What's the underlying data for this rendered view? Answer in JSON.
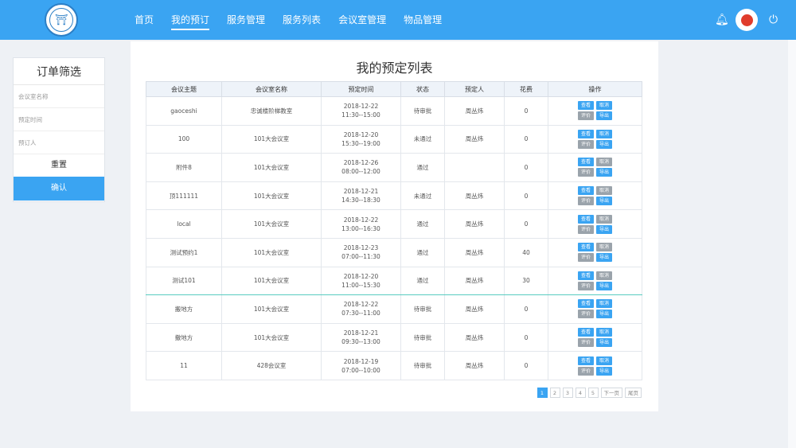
{
  "header": {
    "logo_icon": "university-seal-icon",
    "nav": [
      "首页",
      "我的预订",
      "服务管理",
      "服务列表",
      "会议室管理",
      "物品管理"
    ],
    "active_nav_index": 1
  },
  "sidebar": {
    "title": "订单筛选",
    "fields": [
      {
        "placeholder": "会议室名称"
      },
      {
        "placeholder": "预定时间"
      },
      {
        "placeholder": "预订人"
      }
    ],
    "reset_label": "重置",
    "confirm_label": "确认"
  },
  "main": {
    "title": "我的预定列表",
    "columns": [
      "会议主题",
      "会议室名称",
      "预定时间",
      "状态",
      "预定人",
      "花费",
      "操作"
    ],
    "rows": [
      {
        "topic": "gaoceshi",
        "room": "忠诚楼阶梯教室",
        "date": "2018-12-22",
        "time": "11:30--15:00",
        "status": "待审批",
        "person": "周丛炜",
        "cost": "0",
        "selected": false,
        "ops": [
          [
            "查看",
            "blue"
          ],
          [
            "取消",
            "blue"
          ],
          [
            "评价",
            "gray"
          ],
          [
            "导出",
            "blue"
          ]
        ]
      },
      {
        "topic": "100",
        "room": "101大会议室",
        "date": "2018-12-20",
        "time": "15:30--19:00",
        "status": "未通过",
        "person": "周丛炜",
        "cost": "0",
        "selected": false,
        "ops": [
          [
            "查看",
            "blue"
          ],
          [
            "取消",
            "blue"
          ],
          [
            "评价",
            "gray"
          ],
          [
            "导出",
            "blue"
          ]
        ]
      },
      {
        "topic": "附件8",
        "room": "101大会议室",
        "date": "2018-12-26",
        "time": "08:00--12:00",
        "status": "通过",
        "person": "",
        "cost": "0",
        "selected": false,
        "ops": [
          [
            "查看",
            "blue"
          ],
          [
            "取消",
            "gray"
          ],
          [
            "评价",
            "gray"
          ],
          [
            "导出",
            "blue"
          ]
        ]
      },
      {
        "topic": "顶111111",
        "room": "101大会议室",
        "date": "2018-12-21",
        "time": "14:30--18:30",
        "status": "未通过",
        "person": "周丛炜",
        "cost": "0",
        "selected": false,
        "ops": [
          [
            "查看",
            "blue"
          ],
          [
            "取消",
            "gray"
          ],
          [
            "评价",
            "gray"
          ],
          [
            "导出",
            "blue"
          ]
        ]
      },
      {
        "topic": "local",
        "room": "101大会议室",
        "date": "2018-12-22",
        "time": "13:00--16:30",
        "status": "通过",
        "person": "周丛炜",
        "cost": "0",
        "selected": false,
        "ops": [
          [
            "查看",
            "blue"
          ],
          [
            "取消",
            "gray"
          ],
          [
            "评价",
            "gray"
          ],
          [
            "导出",
            "blue"
          ]
        ]
      },
      {
        "topic": "测试预约1",
        "room": "101大会议室",
        "date": "2018-12-23",
        "time": "07:00--11:30",
        "status": "通过",
        "person": "周丛炜",
        "cost": "40",
        "selected": false,
        "ops": [
          [
            "查看",
            "blue"
          ],
          [
            "取消",
            "gray"
          ],
          [
            "评价",
            "gray"
          ],
          [
            "导出",
            "blue"
          ]
        ]
      },
      {
        "topic": "测试101",
        "room": "101大会议室",
        "date": "2018-12-20",
        "time": "11:00--15:30",
        "status": "通过",
        "person": "周丛炜",
        "cost": "30",
        "selected": true,
        "ops": [
          [
            "查看",
            "blue"
          ],
          [
            "取消",
            "gray"
          ],
          [
            "评价",
            "gray"
          ],
          [
            "导出",
            "blue"
          ]
        ]
      },
      {
        "topic": "搬地方",
        "room": "101大会议室",
        "date": "2018-12-22",
        "time": "07:30--11:00",
        "status": "待审批",
        "person": "周丛炜",
        "cost": "0",
        "selected": false,
        "ops": [
          [
            "查看",
            "blue"
          ],
          [
            "取消",
            "blue"
          ],
          [
            "评价",
            "gray"
          ],
          [
            "导出",
            "blue"
          ]
        ]
      },
      {
        "topic": "撒地方",
        "room": "101大会议室",
        "date": "2018-12-21",
        "time": "09:30--13:00",
        "status": "待审批",
        "person": "周丛炜",
        "cost": "0",
        "selected": false,
        "ops": [
          [
            "查看",
            "blue"
          ],
          [
            "取消",
            "blue"
          ],
          [
            "评价",
            "gray"
          ],
          [
            "导出",
            "blue"
          ]
        ]
      },
      {
        "topic": "11",
        "room": "428会议室",
        "date": "2018-12-19",
        "time": "07:00--10:00",
        "status": "待审批",
        "person": "周丛炜",
        "cost": "0",
        "selected": false,
        "ops": [
          [
            "查看",
            "blue"
          ],
          [
            "取消",
            "blue"
          ],
          [
            "评价",
            "gray"
          ],
          [
            "导出",
            "blue"
          ]
        ]
      }
    ]
  },
  "pagination": {
    "pages": [
      "1",
      "2",
      "3",
      "4",
      "5"
    ],
    "active": "1",
    "next_label": "下一页",
    "last_label": "尾页"
  },
  "colors": {
    "primary": "#3aa4f2",
    "secondary": "#9aa3ab",
    "selected_row_border": "#58cbc0"
  }
}
